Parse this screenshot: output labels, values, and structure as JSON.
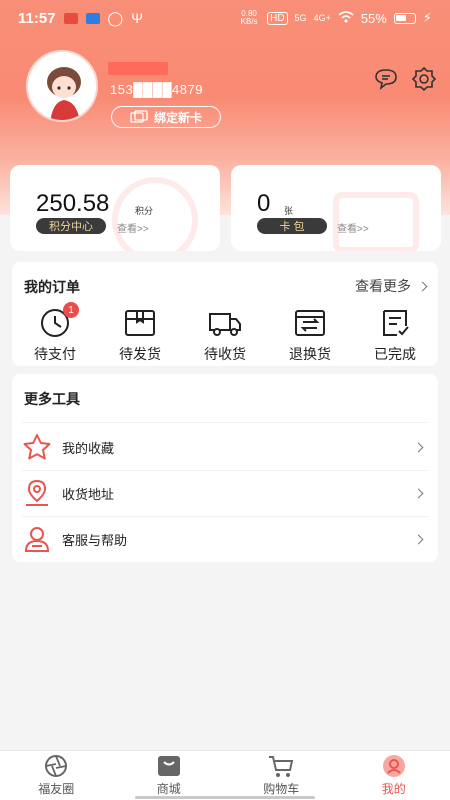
{
  "status_bar": {
    "time": "11:57",
    "speed": "0.80 KB/s",
    "hd": "HD",
    "net1": "5G",
    "net2": "4G+",
    "battery": "55%"
  },
  "profile": {
    "phone": "153████4879",
    "bind_card_label": "绑定新卡"
  },
  "points_card": {
    "value": "250.58",
    "unit": "积分",
    "pill": "积分中心",
    "link": "查看>>"
  },
  "wallet_card": {
    "value": "0",
    "unit": "张",
    "pill": "卡 包",
    "link": "查看>>"
  },
  "orders": {
    "title": "我的订单",
    "more": "查看更多",
    "items": [
      {
        "label": "待支付",
        "badge": "1"
      },
      {
        "label": "待发货"
      },
      {
        "label": "待收货"
      },
      {
        "label": "退换货"
      },
      {
        "label": "已完成"
      }
    ]
  },
  "tools": {
    "title": "更多工具",
    "items": [
      {
        "label": "我的收藏"
      },
      {
        "label": "收货地址"
      },
      {
        "label": "客服与帮助"
      }
    ]
  },
  "tabbar": {
    "items": [
      {
        "label": "福友圈"
      },
      {
        "label": "商城"
      },
      {
        "label": "购物车"
      },
      {
        "label": "我的"
      }
    ],
    "active": "我的"
  },
  "colors": {
    "accent": "#e8564f",
    "header": "#f98f78",
    "pill_bg": "#3a3a3a",
    "pill_text": "#f1d39a"
  }
}
